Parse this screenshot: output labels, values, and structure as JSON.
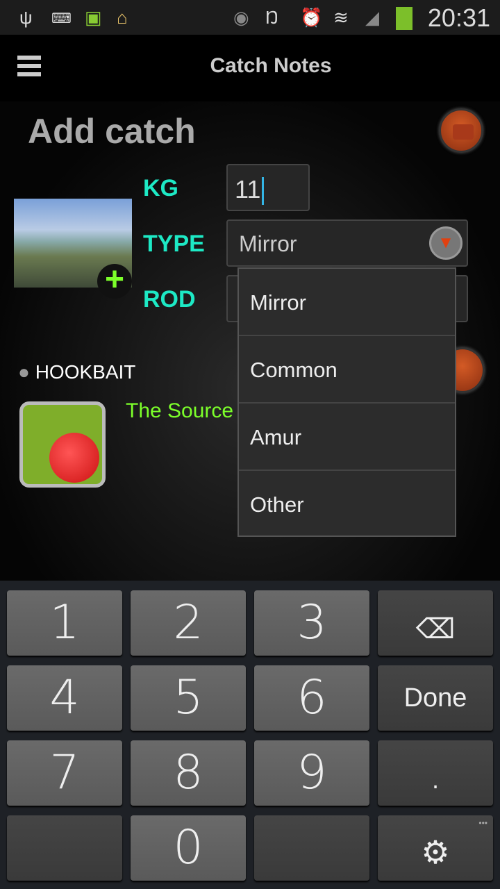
{
  "status_bar": {
    "time": "20:31",
    "icons": [
      "usb-icon",
      "keyboard-icon",
      "android-battery-icon",
      "cleaner-broom-icon",
      "eye-icon",
      "no-vibrate-icon",
      "alarm-icon",
      "wifi-icon",
      "signal-icon",
      "battery-charging-icon"
    ]
  },
  "app_bar": {
    "title": "Catch Notes",
    "menu_icon": "hamburger-menu-icon"
  },
  "form": {
    "heading": "Add catch",
    "kg_label": "KG",
    "kg_value": "11",
    "type_label": "TYPE",
    "type_value": "Mirror",
    "rod_label": "ROD",
    "hookbait_label": "HOOKBAIT",
    "hookbait_value": "The Source"
  },
  "dropdown": {
    "options": [
      "Mirror",
      "Common",
      "Amur",
      "Other"
    ]
  },
  "keyboard": {
    "keys": [
      "1",
      "2",
      "3",
      "",
      "4",
      "5",
      "6",
      "Done",
      "7",
      "8",
      "9",
      ".",
      "",
      "0",
      "",
      ""
    ],
    "more_label": "•••"
  },
  "colors": {
    "label": "#1de9c5",
    "hookbait_value": "#7cff2a",
    "accent": "#d35a25"
  }
}
